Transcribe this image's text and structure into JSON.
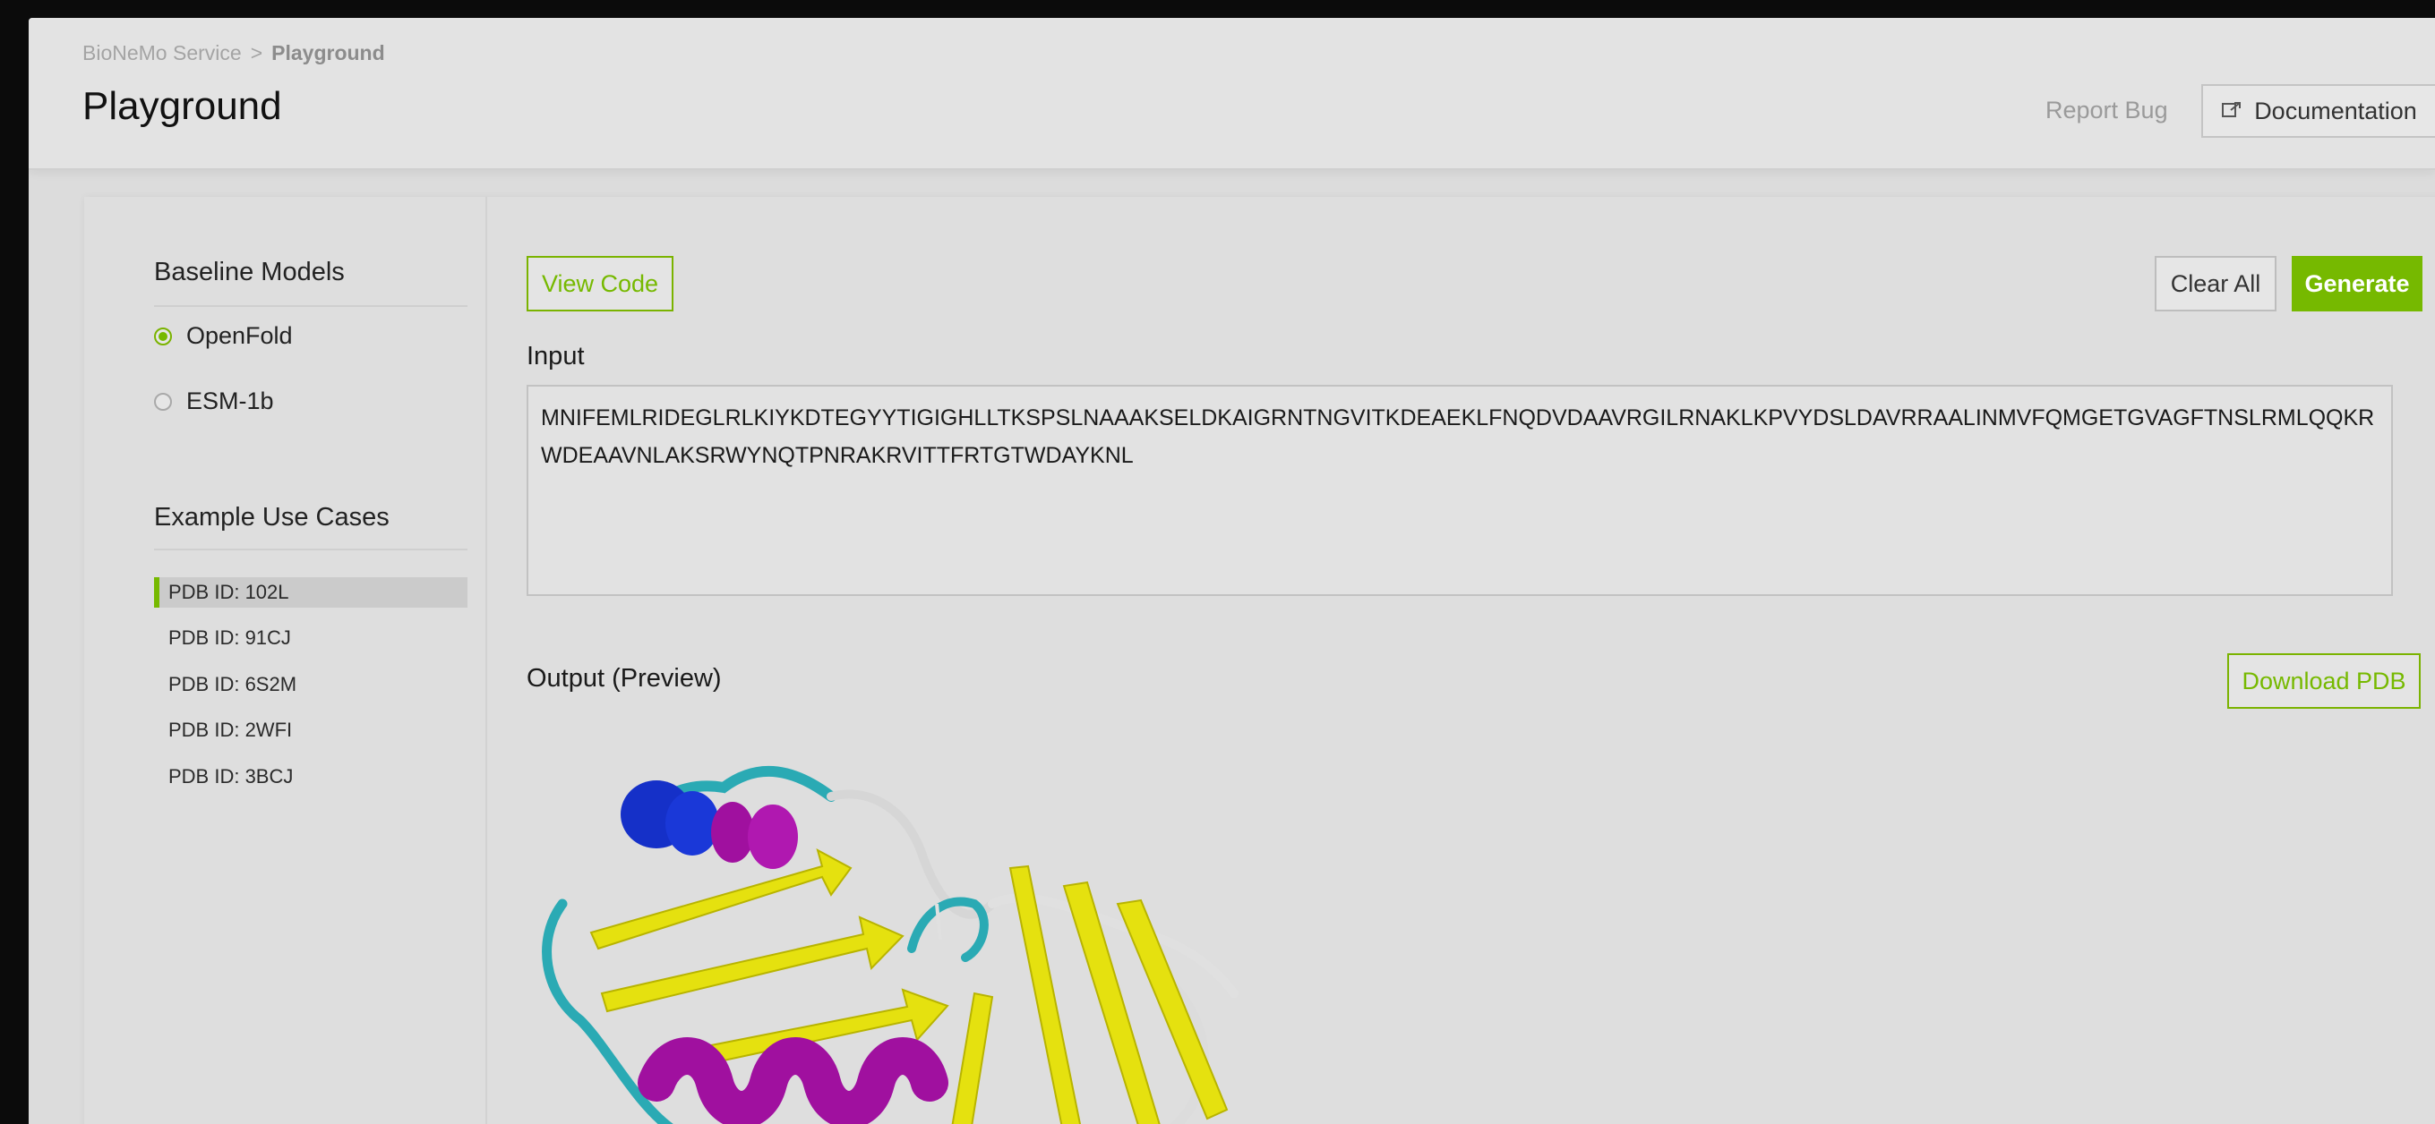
{
  "header": {
    "breadcrumb_root": "BioNeMo Service",
    "breadcrumb_separator": ">",
    "breadcrumb_current": "Playground",
    "page_title": "Playground",
    "report_bug": "Report Bug",
    "documentation": "Documentation"
  },
  "sidebar": {
    "baseline_title": "Baseline Models",
    "models": [
      {
        "label": "OpenFold",
        "selected": true
      },
      {
        "label": "ESM-1b",
        "selected": false
      }
    ],
    "examples_title": "Example Use Cases",
    "examples": [
      {
        "label": "PDB ID: 102L",
        "active": true
      },
      {
        "label": "PDB ID: 91CJ",
        "active": false
      },
      {
        "label": "PDB ID: 6S2M",
        "active": false
      },
      {
        "label": "PDB ID: 2WFI",
        "active": false
      },
      {
        "label": "PDB ID: 3BCJ",
        "active": false
      }
    ]
  },
  "main": {
    "view_code": "View Code",
    "clear_all": "Clear All",
    "generate": "Generate",
    "input_label": "Input",
    "sequence": "MNIFEMLRIDEGLRLKIYKDTEGYYTIGIGHLLTKSPSLNAAAKSELDKAIGRNTNGVITKDEAEKLFNQDVDAAVRGILRNAKLKPVYDSLDAVRRAALINMVFQMGETGVAGFTNSLRMLQQKRWDEAAVNLAKSRWYNQTPNRAKRVITTFRTGTWDAYKNL",
    "output_label": "Output (Preview)",
    "download_pdb": "Download PDB"
  },
  "colors": {
    "accent": "#76b900",
    "helix": "#a0109f",
    "sheet": "#e5e10f",
    "turn": "#2aaab4",
    "coil": "#d8d8d8",
    "helix_alt": "#1530c8"
  },
  "icons": {
    "documentation": "external-link-icon"
  }
}
